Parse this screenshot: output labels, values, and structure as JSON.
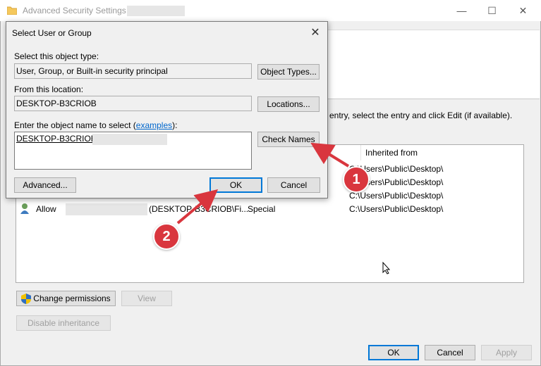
{
  "background_window": {
    "title": "Advanced Security Settings f",
    "instruction": "entry, select the entry and click Edit (if available).",
    "column_inherited_from": "Inherited from",
    "rows": [
      {
        "inherited": "C:\\Users\\Public\\Desktop\\"
      },
      {
        "inherited": "C:\\Users\\Public\\Desktop\\"
      },
      {
        "inherited": "C:\\Users\\Public\\Desktop\\"
      },
      {
        "type": "Allow",
        "principal": "(DESKTOP-B3CRIOB\\Fi...",
        "access": "Special",
        "inherited": "C:\\Users\\Public\\Desktop\\"
      }
    ],
    "buttons": {
      "change_permissions": "Change permissions",
      "view": "View",
      "disable_inheritance": "Disable inheritance",
      "ok": "OK",
      "cancel": "Cancel",
      "apply": "Apply"
    }
  },
  "dialog": {
    "title": "Select User or Group",
    "object_type_label": "Select this object type:",
    "object_type_value": "User, Group, or Built-in security principal",
    "object_types_button": "Object Types...",
    "location_label": "From this location:",
    "location_value": "DESKTOP-B3CRIOB",
    "locations_button": "Locations...",
    "enter_name_label_prefix": "Enter the object name to select (",
    "examples_link": "examples",
    "enter_name_label_suffix": "):",
    "object_name_value": "DESKTOP-B3CRIOB\\",
    "check_names_button": "Check Names",
    "advanced_button": "Advanced...",
    "ok_button": "OK",
    "cancel_button": "Cancel"
  },
  "annotations": [
    {
      "number": "1",
      "color": "#d9363e"
    },
    {
      "number": "2",
      "color": "#d9363e"
    }
  ],
  "icons": [
    "folder-icon",
    "minimize-icon",
    "maximize-icon",
    "close-icon",
    "user-icon",
    "shield-icon",
    "mouse-cursor-icon"
  ]
}
